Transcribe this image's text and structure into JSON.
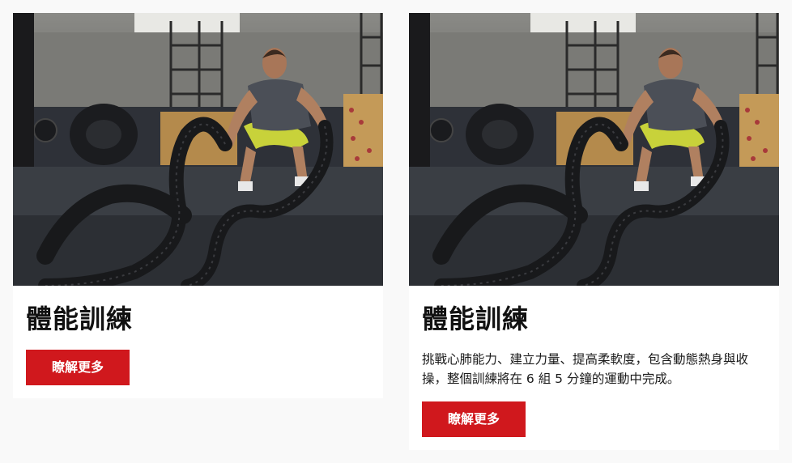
{
  "colors": {
    "page_background": "#f9f9f9",
    "card_background": "#ffffff",
    "button_background": "#d0181d",
    "button_text": "#ffffff",
    "title_text": "#111111"
  },
  "cards": [
    {
      "image_subject": "man training with battle ropes in gym",
      "title": "體能訓練",
      "description": "",
      "button_label": "瞭解更多"
    },
    {
      "image_subject": "man training with battle ropes in gym",
      "title": "體能訓練",
      "description": "挑戰心肺能力、建立力量、提高柔軟度，包含動態熱身與收操，整個訓練將在 6 組 5 分鐘的運動中完成。",
      "button_label": "瞭解更多"
    }
  ]
}
